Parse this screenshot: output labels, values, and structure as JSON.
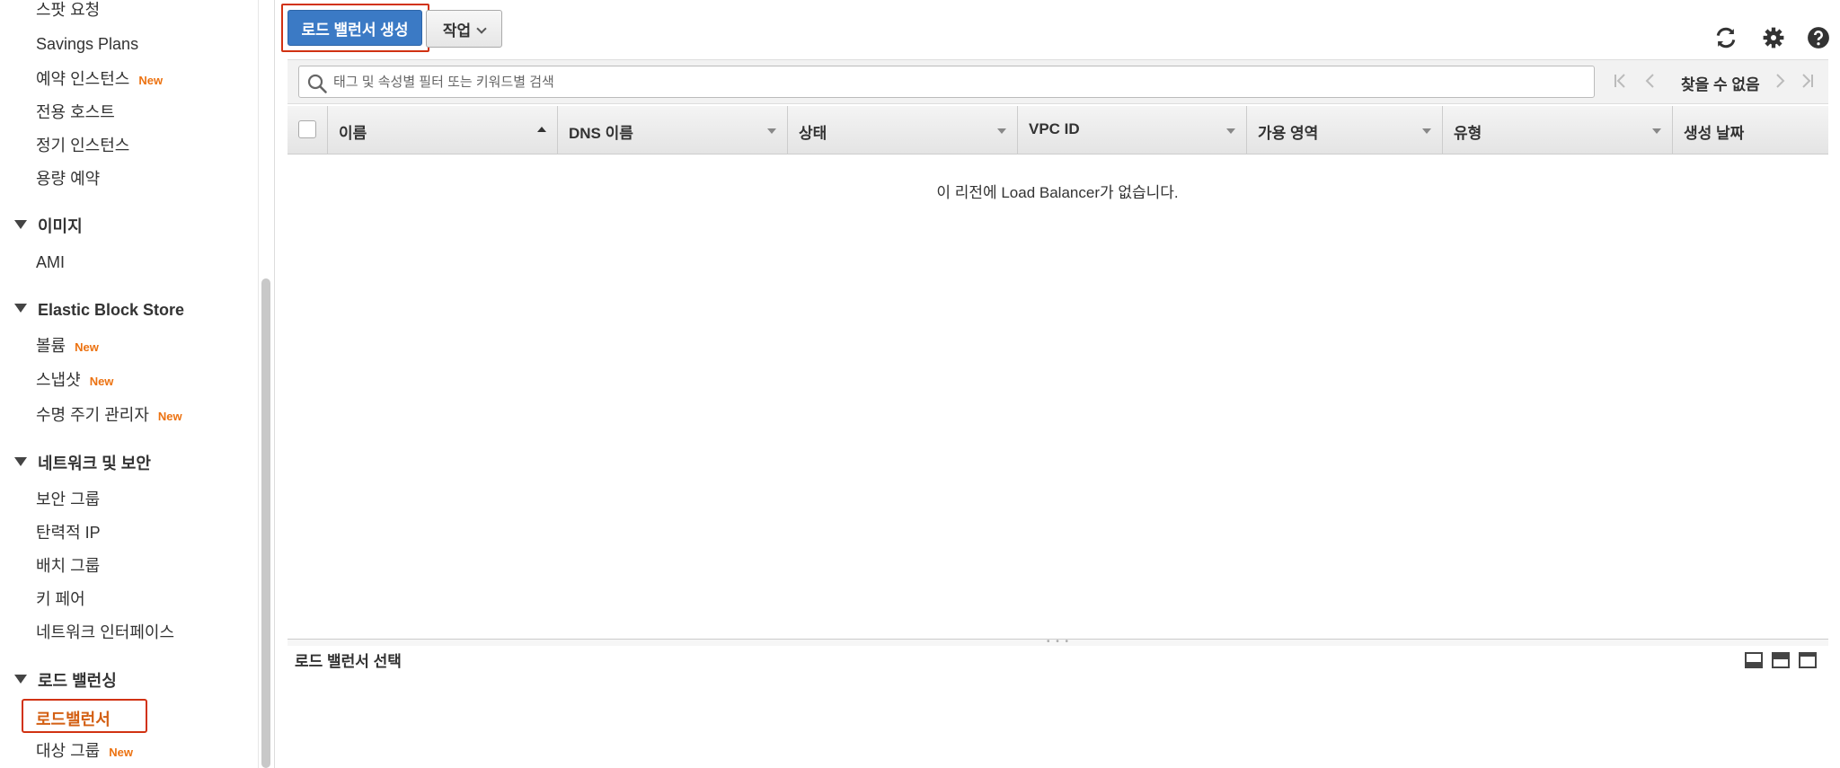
{
  "sidebar": {
    "items": [
      {
        "label": "스팟 요청",
        "new": false
      },
      {
        "label": "Savings Plans",
        "new": false
      },
      {
        "label": "예약 인스턴스",
        "new": true
      },
      {
        "label": "전용 호스트",
        "new": false
      },
      {
        "label": "정기 인스턴스",
        "new": false
      },
      {
        "label": "용량 예약",
        "new": false
      }
    ],
    "sections": {
      "images": {
        "title": "이미지",
        "items": [
          "AMI"
        ]
      },
      "ebs": {
        "title": "Elastic Block Store",
        "items": [
          {
            "label": "볼륨",
            "new": true
          },
          {
            "label": "스냅샷",
            "new": true
          },
          {
            "label": "수명 주기 관리자",
            "new": true
          }
        ]
      },
      "network": {
        "title": "네트워크 및 보안",
        "items": [
          "보안 그룹",
          "탄력적 IP",
          "배치 그룹",
          "키 페어",
          "네트워크 인터페이스"
        ]
      },
      "lb": {
        "title": "로드 밸런싱",
        "items": [
          {
            "label": "로드밸런서",
            "new": false,
            "active": true
          },
          {
            "label": "대상 그룹",
            "new": true
          }
        ]
      }
    },
    "new_badge": "New"
  },
  "toolbar": {
    "create_label": "로드 밸런서 생성",
    "actions_label": "작업"
  },
  "search": {
    "placeholder": "태그 및 속성별 필터 또는 키워드별 검색",
    "value": ""
  },
  "pagination": {
    "status": "찾을 수 없음"
  },
  "table": {
    "columns": [
      "이름",
      "DNS 이름",
      "상태",
      "VPC ID",
      "가용 영역",
      "유형",
      "생성 날짜"
    ],
    "empty_message": "이 리전에 Load Balancer가 없습니다."
  },
  "detail": {
    "title": "로드 밸런서 선택"
  },
  "colors": {
    "primary": "#3b7ac5",
    "highlight": "#d13212",
    "new_badge": "#ec7211",
    "active_link": "#d35f13"
  },
  "icons": [
    "refresh-icon",
    "gear-icon",
    "help-icon",
    "search-icon",
    "first-page-icon",
    "prev-page-icon",
    "next-page-icon",
    "last-page-icon"
  ]
}
